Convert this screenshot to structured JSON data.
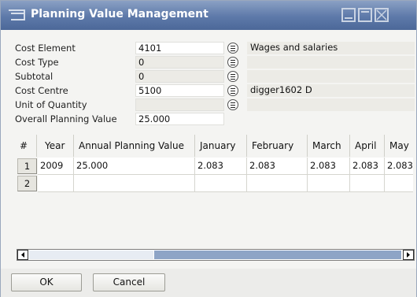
{
  "window": {
    "title": "Planning Value Management",
    "icon": "planning-app-icon"
  },
  "fields": [
    {
      "label": "Cost Element",
      "value": "4101",
      "description": "Wages and salaries",
      "value_bg": "white"
    },
    {
      "label": "Cost Type",
      "value": "0",
      "description": "",
      "value_bg": "grey"
    },
    {
      "label": "Subtotal",
      "value": "0",
      "description": "",
      "value_bg": "grey"
    },
    {
      "label": "Cost Centre",
      "value": "5100",
      "description": "digger1602 D",
      "value_bg": "white"
    },
    {
      "label": "Unit of Quantity",
      "value": "",
      "description": "",
      "value_bg": "grey"
    },
    {
      "label": "Overall Planning Value",
      "value": "25.000"
    }
  ],
  "grid": {
    "columns": [
      "#",
      "Year",
      "Annual Planning Value",
      "January",
      "February",
      "March",
      "April",
      "May"
    ],
    "rows": [
      {
        "num": "1",
        "cells": [
          "2009",
          "25.000",
          "2.083",
          "2.083",
          "2.083",
          "2.083",
          "2.083"
        ]
      },
      {
        "num": "2",
        "cells": [
          "",
          "",
          "",
          "",
          "",
          "",
          ""
        ]
      }
    ]
  },
  "buttons": {
    "ok": "OK",
    "cancel": "Cancel"
  },
  "colors": {
    "titlebar": "#5d79a9",
    "scroll_thumb": "#8ea4c6",
    "window_bg": "#f4f4f2"
  }
}
